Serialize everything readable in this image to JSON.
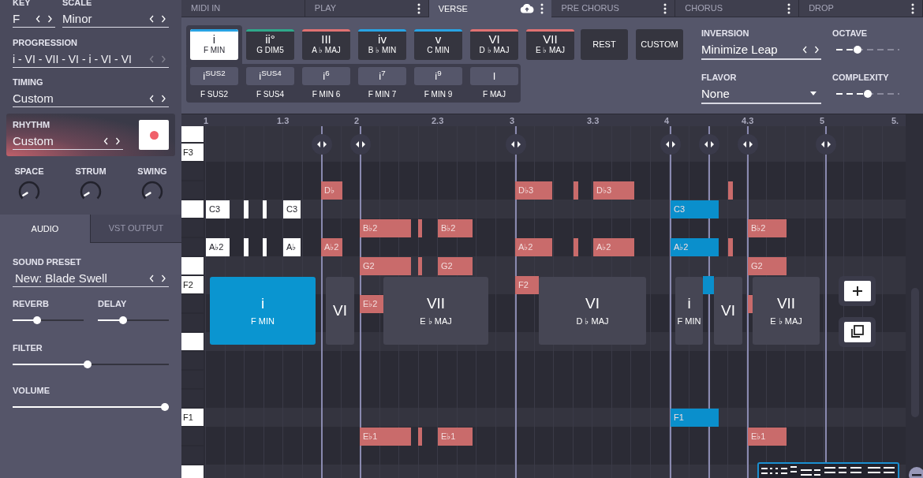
{
  "section_tabs": [
    {
      "label": "MIDI IN",
      "selected": false,
      "menu": false,
      "cloud": false
    },
    {
      "label": "PLAY",
      "selected": false,
      "menu": true,
      "cloud": false
    },
    {
      "label": "VERSE",
      "selected": true,
      "menu": true,
      "cloud": true
    },
    {
      "label": "PRE CHORUS",
      "selected": false,
      "menu": true,
      "cloud": false
    },
    {
      "label": "CHORUS",
      "selected": false,
      "menu": true,
      "cloud": false
    },
    {
      "label": "DROP",
      "selected": false,
      "menu": true,
      "cloud": false
    }
  ],
  "left_panel": {
    "key": {
      "label": "KEY",
      "value": "F",
      "arrows_disabled": false
    },
    "scale": {
      "label": "SCALE",
      "value": "Minor",
      "arrows_disabled": false
    },
    "progression": {
      "label": "PROGRESSION",
      "value": "i - VI - VII - VI - i - VI - VI",
      "arrows_disabled": true
    },
    "timing": {
      "label": "TIMING",
      "value": "Custom",
      "arrows_disabled": false
    },
    "rhythm": {
      "label": "RHYTHM",
      "value": "Custom",
      "arrows_disabled": false
    },
    "knobs": [
      {
        "label": "SPACE",
        "level": 0.05
      },
      {
        "label": "STRUM",
        "level": 0.05
      },
      {
        "label": "SWING",
        "level": 0.05
      }
    ],
    "output_tabs": [
      {
        "label": "AUDIO",
        "selected": true
      },
      {
        "label": "VST OUTPUT",
        "selected": false
      }
    ],
    "sound_preset": {
      "label": "SOUND PRESET",
      "value": "New: Blade Swell",
      "arrows_disabled": false
    },
    "sliders": [
      {
        "label": "REVERB",
        "kind": "half",
        "level": 0.33
      },
      {
        "label": "DELAY",
        "kind": "half",
        "level": 0.34
      },
      {
        "label": "FILTER",
        "kind": "full",
        "level": 0.48
      },
      {
        "label": "VOLUME",
        "kind": "full",
        "level": 1
      }
    ]
  },
  "chord_palette": {
    "chords": [
      {
        "numeral": "i",
        "name": "F MIN",
        "color": "#29a3e3",
        "selected": true
      },
      {
        "numeral": "ii°",
        "name": "G DIM5",
        "color": "#2fa88a",
        "selected": false
      },
      {
        "numeral": "III",
        "name": "A ♭ MAJ",
        "color": "#e07272",
        "selected": false
      },
      {
        "numeral": "iv",
        "name": "B ♭ MIN",
        "color": "#29a3e3",
        "selected": false
      },
      {
        "numeral": "v",
        "name": "C MIN",
        "color": "#29a3e3",
        "selected": false
      },
      {
        "numeral": "VI",
        "name": "D ♭ MAJ",
        "color": "#e07272",
        "selected": false
      },
      {
        "numeral": "VII",
        "name": "E ♭ MAJ",
        "color": "#e07272",
        "selected": false
      }
    ],
    "variations": [
      {
        "symbol": "i$^{SUS2}$",
        "name": "F SUS2"
      },
      {
        "symbol": "i$^{SUS4}$",
        "name": "F SUS4"
      },
      {
        "symbol": "i$^{6}$",
        "name": "F MIN 6"
      },
      {
        "symbol": "i$^{7}$",
        "name": "F MIN 7"
      },
      {
        "symbol": "i$^{9}$",
        "name": "F MIN 9"
      },
      {
        "symbol": "I",
        "name": "F MAJ"
      }
    ],
    "buttons": [
      "REST",
      "CUSTOM"
    ],
    "inversion": {
      "label": "INVERSION",
      "value": "Minimize Leap"
    },
    "flavor": {
      "label": "FLAVOR",
      "value": "None"
    },
    "octave": {
      "label": "OCTAVE",
      "level": 0.333
    },
    "complexity": {
      "label": "COMPLEXITY",
      "level": 0.5
    }
  },
  "piano_roll": {
    "ruler": [
      "1",
      "1.3",
      "2",
      "2.3",
      "3",
      "3.3",
      "4",
      "4.3",
      "5",
      "5."
    ],
    "keys": [
      {
        "kind": "white"
      },
      {
        "kind": "white",
        "label": "F3"
      },
      {
        "kind": "black"
      },
      {
        "kind": "black"
      },
      {
        "kind": "white"
      },
      {
        "kind": "black"
      },
      {
        "kind": "black"
      },
      {
        "kind": "white"
      },
      {
        "kind": "white",
        "label": "F2"
      },
      {
        "kind": "black"
      },
      {
        "kind": "black"
      },
      {
        "kind": "white"
      },
      {
        "kind": "black"
      },
      {
        "kind": "black"
      },
      {
        "kind": "black"
      },
      {
        "kind": "white",
        "label": "F1"
      },
      {
        "kind": "black"
      },
      {
        "kind": "black"
      },
      {
        "kind": "white"
      }
    ],
    "notes": [
      {
        "label": "C3",
        "color": "#ffffff"
      },
      {
        "color": "#ffffff"
      },
      {
        "color": "#ffffff"
      },
      {
        "label": "C3",
        "color": "#ffffff"
      },
      {
        "label": "A♭2",
        "color": "#ffffff"
      },
      {
        "color": "#ffffff"
      },
      {
        "color": "#ffffff"
      },
      {
        "label": "A♭",
        "color": "#ffffff"
      },
      {
        "label": "D♭",
        "color": "#c96b6b"
      },
      {
        "label": "A♭2",
        "color": "#c96b6b"
      },
      {
        "label": "B♭2",
        "color": "#c96b6b"
      },
      {
        "color": "#c96b6b"
      },
      {
        "label": "B♭2",
        "color": "#c96b6b"
      },
      {
        "label": "G2",
        "color": "#c96b6b"
      },
      {
        "color": "#c96b6b"
      },
      {
        "label": "G2",
        "color": "#c96b6b"
      },
      {
        "label": "E♭2",
        "color": "#c96b6b"
      },
      {
        "label": "E♭1",
        "color": "#c96b6b"
      },
      {
        "color": "#c96b6b"
      },
      {
        "label": "E♭1",
        "color": "#c96b6b"
      },
      {
        "label": "D♭3",
        "color": "#c96b6b"
      },
      {
        "color": "#c96b6b"
      },
      {
        "label": "D♭3",
        "color": "#c96b6b"
      },
      {
        "label": "A♭2",
        "color": "#c96b6b"
      },
      {
        "color": "#c96b6b"
      },
      {
        "label": "A♭2",
        "color": "#c96b6b"
      },
      {
        "label": "F2",
        "color": "#c96b6b"
      },
      {
        "label": "C3",
        "color": "#0a8fcc"
      },
      {
        "label": "A♭2",
        "color": "#0a8fcc"
      },
      {
        "color": "#0a8fcc"
      },
      {
        "label": "F1",
        "color": "#0a8fcc"
      },
      {
        "color": "#c96b6b"
      },
      {
        "color": "#c96b6b"
      },
      {
        "label": "B♭2",
        "color": "#c96b6b"
      },
      {
        "label": "G2",
        "color": "#c96b6b"
      },
      {
        "color": "#c96b6b"
      },
      {
        "label": "E♭1",
        "color": "#c96b6b"
      }
    ],
    "chords": [
      {
        "numeral": "i",
        "name": "F MIN",
        "selected": true
      },
      {
        "numeral": "VI",
        "selected": false
      },
      {
        "numeral": "VII",
        "name": "E ♭ MAJ",
        "selected": false
      },
      {
        "numeral": "VI",
        "name": "D ♭ MAJ",
        "selected": false
      },
      {
        "numeral": "i",
        "name": "F MIN",
        "selected": false
      },
      {
        "numeral": "VI",
        "selected": false
      },
      {
        "numeral": "VII",
        "name": "E ♭ MAJ",
        "selected": false
      }
    ]
  }
}
